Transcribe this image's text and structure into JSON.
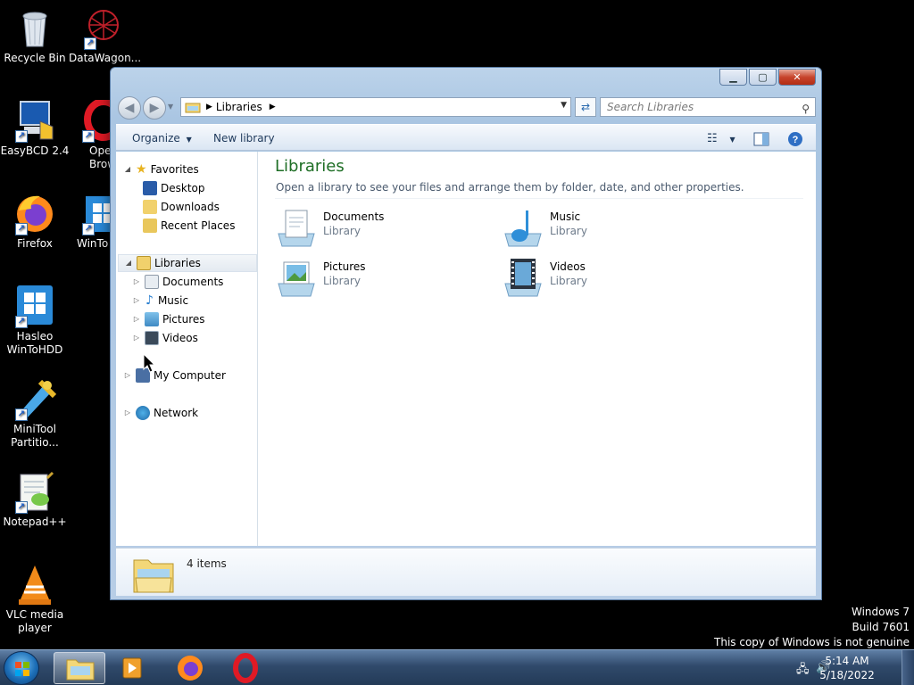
{
  "desktop": {
    "icons": [
      {
        "label": "Recycle Bin",
        "icon": "recycle-bin-icon"
      },
      {
        "label": "DataWagon...",
        "icon": "datawagon-icon"
      },
      {
        "label": "EasyBCD 2.4",
        "icon": "easybcd-icon"
      },
      {
        "label": "Ope Brow",
        "icon": "opera-icon"
      },
      {
        "label": "Firefox",
        "icon": "firefox-icon"
      },
      {
        "label": "WinTo",
        "icon": "wintousb-icon"
      },
      {
        "label": "Hasleo WinToHDD",
        "icon": "wintohdd-icon"
      },
      {
        "label": "MiniTool Partitio...",
        "icon": "minitool-icon"
      },
      {
        "label": "Notepad++",
        "icon": "notepadpp-icon"
      },
      {
        "label": "VLC media player",
        "icon": "vlc-icon"
      }
    ]
  },
  "explorer": {
    "breadcrumb": "Libraries",
    "search_placeholder": "Search Libraries",
    "toolbar": {
      "organize": "Organize",
      "new_library": "New library"
    },
    "nav": {
      "favorites": "Favorites",
      "favorite_items": [
        "Desktop",
        "Downloads",
        "Recent Places"
      ],
      "libraries": "Libraries",
      "library_items": [
        "Documents",
        "Music",
        "Pictures",
        "Videos"
      ],
      "computer": "My Computer",
      "network": "Network"
    },
    "content": {
      "title": "Libraries",
      "description": "Open a library to see your files and arrange them by folder, date, and other properties.",
      "libraries": [
        {
          "name": "Documents",
          "type": "Library"
        },
        {
          "name": "Music",
          "type": "Library"
        },
        {
          "name": "Pictures",
          "type": "Library"
        },
        {
          "name": "Videos",
          "type": "Library"
        }
      ]
    },
    "details": {
      "count": "4 items"
    }
  },
  "watermark": {
    "line1": "Windows 7",
    "line2": "Build 7601",
    "line3": "This copy of Windows is not genuine"
  },
  "taskbar": {
    "time": "5:14 AM",
    "date": "5/18/2022"
  },
  "colors": {
    "title_green": "#1e6e25",
    "desktop_bg": "#000000",
    "taskbar": "#2d466a"
  }
}
